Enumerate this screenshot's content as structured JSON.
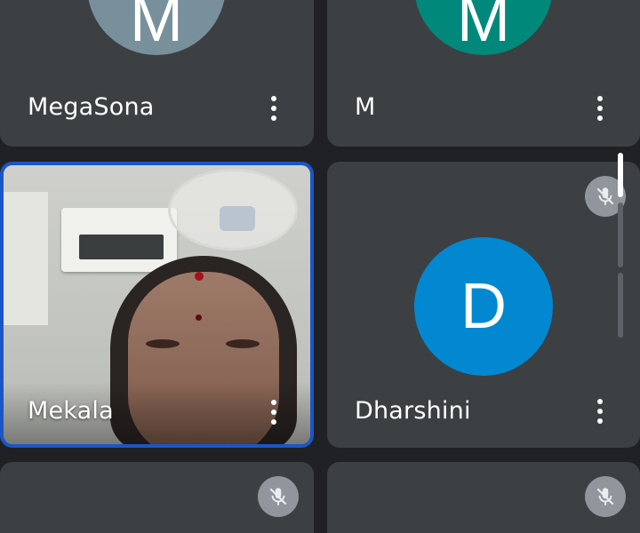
{
  "participants": [
    {
      "name": "MegaSona",
      "initial": "M",
      "avatar_color": "#78909c",
      "muted": false,
      "video": false
    },
    {
      "name": "M",
      "initial": "M",
      "avatar_color": "#00897b",
      "muted": false,
      "video": false
    },
    {
      "name": "Mekala",
      "initial": "",
      "avatar_color": "",
      "muted": false,
      "video": true,
      "active_speaker": true
    },
    {
      "name": "Dharshini",
      "initial": "D",
      "avatar_color": "#0288d1",
      "muted": true,
      "video": false
    },
    {
      "name": "",
      "initial": "",
      "avatar_color": "",
      "muted": true,
      "video": false
    },
    {
      "name": "",
      "initial": "",
      "avatar_color": "",
      "muted": true,
      "video": false
    }
  ],
  "icons": {
    "more": "more-vert-icon",
    "mute": "mic-off-icon"
  },
  "colors": {
    "background": "#202124",
    "tile": "#3c4043",
    "active_border": "#1a56c7"
  }
}
